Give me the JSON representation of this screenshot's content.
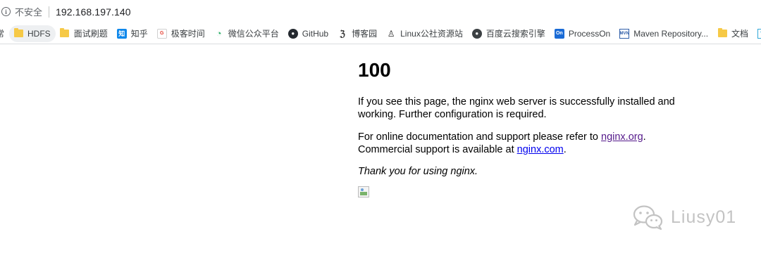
{
  "address_bar": {
    "info_icon": "info-icon",
    "security_text": "不安全",
    "url": "192.168.197.140"
  },
  "bookmarks": [
    {
      "label": "常",
      "icon": "truncated"
    },
    {
      "label": "HDFS",
      "icon": "folder-icon"
    },
    {
      "label": "面试刷题",
      "icon": "folder-icon"
    },
    {
      "label": "知乎",
      "icon": "zhihu-icon",
      "icon_text": "知"
    },
    {
      "label": "极客时间",
      "icon": "geektime-icon",
      "icon_text": "G"
    },
    {
      "label": "微信公众平台",
      "icon": "wechat-icon",
      "icon_text": "◔"
    },
    {
      "label": "GitHub",
      "icon": "github-icon",
      "icon_text": "●"
    },
    {
      "label": "博客园",
      "icon": "cnblogs-icon",
      "icon_text": "ℨ"
    },
    {
      "label": "Linux公社资源站",
      "icon": "linux-icon",
      "icon_text": "♙"
    },
    {
      "label": "百度云搜索引擎",
      "icon": "baidu-icon",
      "icon_text": "●"
    },
    {
      "label": "ProcessOn",
      "icon": "processon-icon",
      "icon_text": "On"
    },
    {
      "label": "Maven Repository...",
      "icon": "maven-icon",
      "icon_text": "MVN"
    },
    {
      "label": "文档",
      "icon": "folder-icon"
    },
    {
      "label": "",
      "icon": "wj-icon",
      "icon_text": "W"
    }
  ],
  "page": {
    "heading": "100",
    "para1": "If you see this page, the nginx web server is successfully installed and working. Further configuration is required.",
    "para2_before": "For online documentation and support please refer to ",
    "para2_link1": "nginx.org",
    "para2_middle": ".",
    "para2_line2_before": "Commercial support is available at ",
    "para2_link2": "nginx.com",
    "para2_end": ".",
    "para3": "Thank you for using nginx."
  },
  "watermark": {
    "text": "Liusy01",
    "icon": "wechat-watermark-icon"
  },
  "colors": {
    "visited_link": "#551a8b",
    "link": "#0000ee",
    "folder": "#f6c946"
  }
}
